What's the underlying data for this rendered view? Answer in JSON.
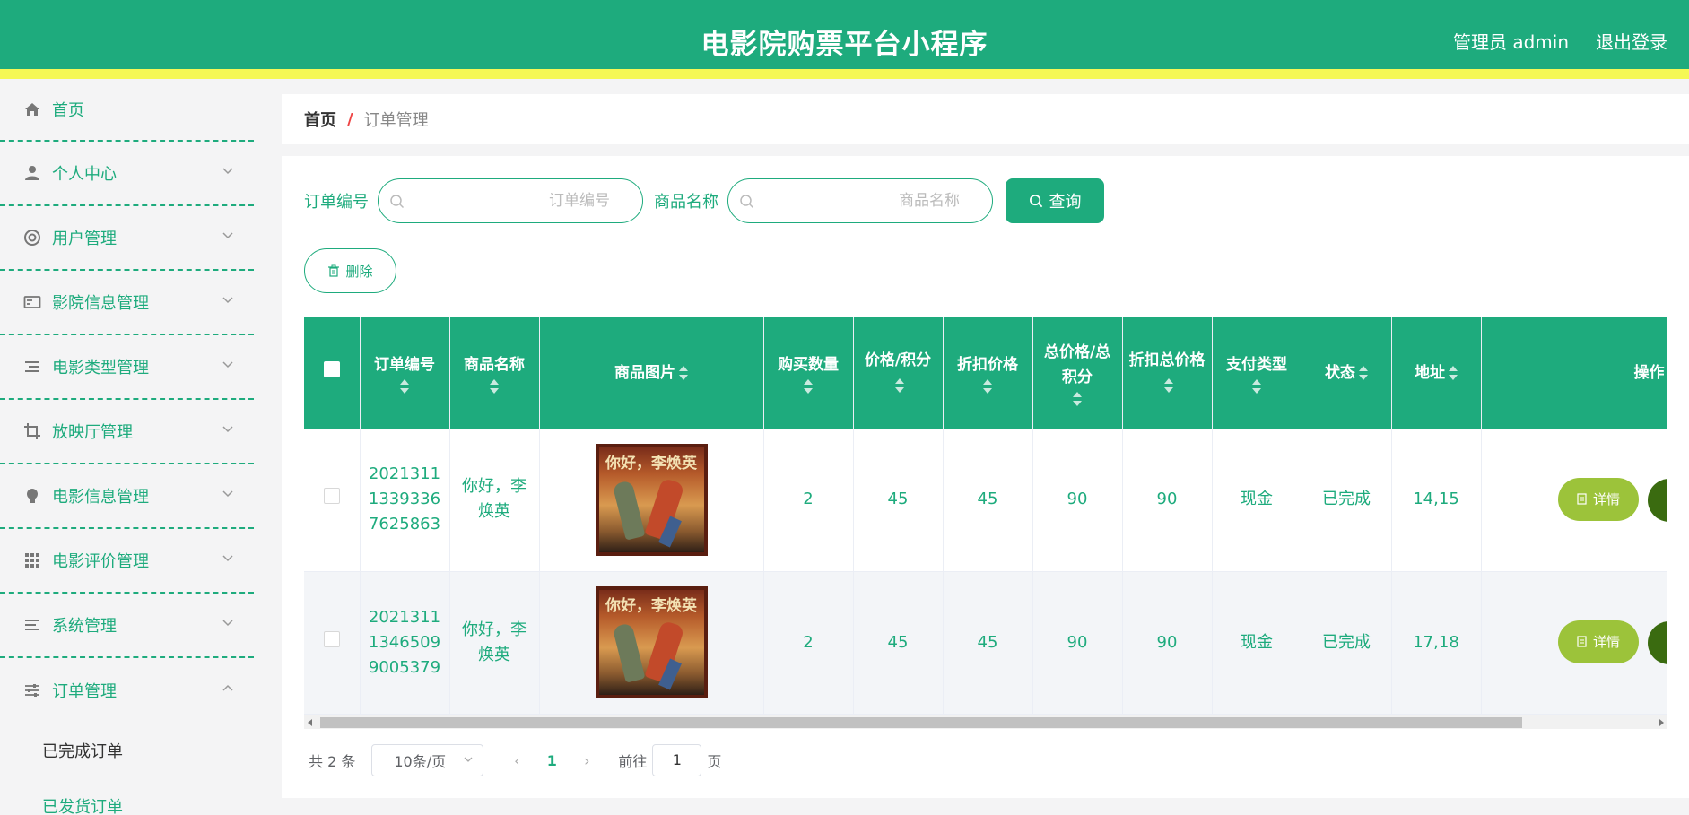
{
  "header": {
    "title": "电影院购票平台小程序",
    "user_label": "管理员 admin",
    "logout_label": "退出登录"
  },
  "sidebar": {
    "items": [
      {
        "label": "首页",
        "icon": "home-icon"
      },
      {
        "label": "个人中心",
        "icon": "user-icon"
      },
      {
        "label": "用户管理",
        "icon": "lifebuoy-icon"
      },
      {
        "label": "影院信息管理",
        "icon": "card-icon"
      },
      {
        "label": "电影类型管理",
        "icon": "list-icon"
      },
      {
        "label": "放映厅管理",
        "icon": "crop-icon"
      },
      {
        "label": "电影信息管理",
        "icon": "bulb-icon"
      },
      {
        "label": "电影评价管理",
        "icon": "grid-icon"
      },
      {
        "label": "系统管理",
        "icon": "lines-icon"
      },
      {
        "label": "订单管理",
        "icon": "sliders-icon"
      }
    ],
    "submenu": [
      {
        "label": "已完成订单"
      },
      {
        "label": "已发货订单"
      }
    ]
  },
  "breadcrumb": {
    "home": "首页",
    "separator": "/",
    "current": "订单管理"
  },
  "search": {
    "order_no_label": "订单编号",
    "order_no_placeholder": "订单编号",
    "goods_name_label": "商品名称",
    "goods_name_placeholder": "商品名称",
    "query_label": "查询",
    "delete_label": "删除"
  },
  "table": {
    "headers": {
      "order_no": "订单编号",
      "goods_name": "商品名称",
      "goods_image": "商品图片",
      "quantity": "购买数量",
      "price": "价格/积分",
      "discount_price": "折扣价格",
      "total": "总价格/总积分",
      "discount_total": "折扣总价格",
      "pay_type": "支付类型",
      "status": "状态",
      "address": "地址",
      "actions": "操作"
    },
    "rows": [
      {
        "order_no": "20213111339336762 5863",
        "order_no_lines": [
          "2021311",
          "1339336",
          "7625863"
        ],
        "goods_name_lines": [
          "你好，李",
          "焕英"
        ],
        "poster_title": "你好，李焕英",
        "quantity": "2",
        "price": "45",
        "discount_price": "45",
        "total": "90",
        "discount_total": "90",
        "pay_type": "现金",
        "status": "已完成",
        "address": "14,15",
        "detail_label": "详情"
      },
      {
        "order_no": "202131113465099005379",
        "order_no_lines": [
          "2021311",
          "1346509",
          "9005379"
        ],
        "goods_name_lines": [
          "你好，李",
          "焕英"
        ],
        "poster_title": "你好，李焕英",
        "quantity": "2",
        "price": "45",
        "discount_price": "45",
        "total": "90",
        "discount_total": "90",
        "pay_type": "现金",
        "status": "已完成",
        "address": "17,18",
        "detail_label": "详情"
      }
    ]
  },
  "pagination": {
    "total_text": "共 2 条",
    "page_size": "10条/页",
    "current_page": "1",
    "goto_label": "前往",
    "goto_value": "1",
    "page_suffix": "页"
  },
  "colors": {
    "primary": "#1eab7d",
    "header_stripe": "#f5f855",
    "detail_button": "#9cc33a"
  }
}
